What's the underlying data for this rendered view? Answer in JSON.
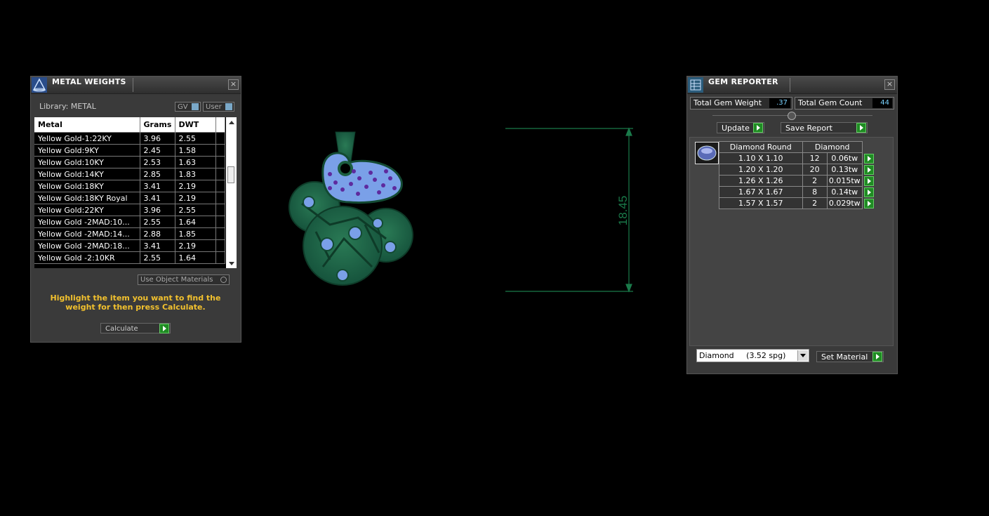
{
  "metal_weights": {
    "title": "METAL WEIGHTS",
    "library_label": "Library: METAL",
    "toggle_gv": "GV",
    "toggle_user": "User",
    "columns": [
      "Metal",
      "Grams",
      "DWT"
    ],
    "rows": [
      [
        "Yellow Gold-1:22KY",
        "3.96",
        "2.55"
      ],
      [
        "Yellow Gold:9KY",
        "2.45",
        "1.58"
      ],
      [
        "Yellow Gold:10KY",
        "2.53",
        "1.63"
      ],
      [
        "Yellow Gold:14KY",
        "2.85",
        "1.83"
      ],
      [
        "Yellow Gold:18KY",
        "3.41",
        "2.19"
      ],
      [
        "Yellow Gold:18KY Royal",
        "3.41",
        "2.19"
      ],
      [
        "Yellow Gold:22KY",
        "3.96",
        "2.55"
      ],
      [
        "Yellow Gold -2MAD:10...",
        "2.55",
        "1.64"
      ],
      [
        "Yellow Gold -2MAD:14...",
        "2.88",
        "1.85"
      ],
      [
        "Yellow Gold -2MAD:18...",
        "3.41",
        "2.19"
      ],
      [
        "Yellow Gold -2:10KR",
        "2.55",
        "1.64"
      ]
    ],
    "use_object_materials": "Use Object Materials",
    "instruction": "Highlight the item you want to find the weight for then press Calculate.",
    "calculate_label": "Calculate"
  },
  "viewport": {
    "dimension_label": "18.45",
    "colors": {
      "metal": "#1c5e40",
      "metal_edge": "#0e3b28",
      "pave": "#7aa0e8",
      "stone": "#5e2a9e",
      "dimension": "#1a7a4a"
    }
  },
  "gem_reporter": {
    "title": "GEM REPORTER",
    "total_weight_label": "Total Gem Weight",
    "total_weight_value": ".37",
    "total_count_label": "Total Gem Count",
    "total_count_value": "44",
    "update_label": "Update",
    "save_report_label": "Save Report",
    "table_header": [
      "Diamond Round",
      "Diamond"
    ],
    "rows": [
      [
        "1.10 X 1.10",
        "12",
        "0.06tw"
      ],
      [
        "1.20 X 1.20",
        "20",
        "0.13tw"
      ],
      [
        "1.26 X 1.26",
        "2",
        "0.015tw"
      ],
      [
        "1.67 X 1.67",
        "8",
        "0.14tw"
      ],
      [
        "1.57 X 1.57",
        "2",
        "0.029tw"
      ]
    ],
    "material_select": "Diamond     (3.52 spg)",
    "set_material_label": "Set Material"
  }
}
